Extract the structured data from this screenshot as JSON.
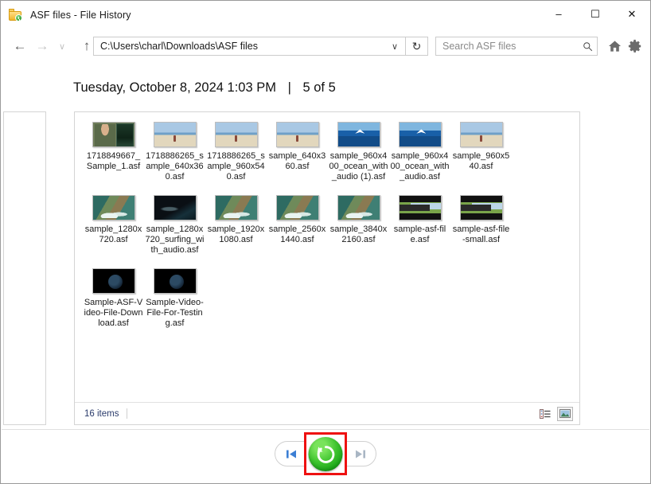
{
  "window": {
    "title": "ASF files - File History",
    "title_icon": "folder-history-icon",
    "controls": {
      "minimize": "–",
      "maximize": "☐",
      "close": "✕"
    }
  },
  "toolbar": {
    "back_icon": "←",
    "forward_icon": "→",
    "recent_icon": "∨",
    "up_icon": "↑",
    "address_value": "C:\\Users\\charl\\Downloads\\ASF files",
    "address_dropdown_icon": "∨",
    "refresh_icon": "↻",
    "search_placeholder": "Search ASF files",
    "search_icon": "⚲",
    "home_icon": "home-icon",
    "settings_icon": "gear-icon"
  },
  "header": {
    "datetime": "Tuesday, October 8, 2024 1:03 PM",
    "separator": "|",
    "position": "5 of 5"
  },
  "files": [
    {
      "name": "1718849667_Sample_1.asf",
      "thumb": "t-person"
    },
    {
      "name": "1718886265_sample_640x360.asf",
      "thumb": "t-beach"
    },
    {
      "name": "1718886265_sample_960x540.asf",
      "thumb": "t-beach"
    },
    {
      "name": "sample_640x360.asf",
      "thumb": "t-beach"
    },
    {
      "name": "sample_960x400_ocean_with_audio (1).asf",
      "thumb": "t-ocean"
    },
    {
      "name": "sample_960x400_ocean_with_audio.asf",
      "thumb": "t-ocean"
    },
    {
      "name": "sample_960x540.asf",
      "thumb": "t-beach"
    },
    {
      "name": "sample_1280x720.asf",
      "thumb": "t-rock"
    },
    {
      "name": "sample_1280x720_surfing_with_audio.asf",
      "thumb": "t-dark"
    },
    {
      "name": "sample_1920x1080.asf",
      "thumb": "t-rock"
    },
    {
      "name": "sample_2560x1440.asf",
      "thumb": "t-rock"
    },
    {
      "name": "sample_3840x2160.asf",
      "thumb": "t-rock"
    },
    {
      "name": "sample-asf-file.asf",
      "thumb": "t-cat"
    },
    {
      "name": "sample-asf-file-small.asf",
      "thumb": "t-cat"
    },
    {
      "name": "Sample-ASF-Video-File-Download.asf",
      "thumb": "t-moon"
    },
    {
      "name": "Sample-Video-File-For-Testing.asf",
      "thumb": "t-moon"
    }
  ],
  "status": {
    "item_count": "16 items",
    "view_details_icon": "details-view-icon",
    "view_thumbnails_icon": "thumbnails-view-icon"
  },
  "bottom_nav": {
    "previous_label": "previous-version-icon",
    "restore_label": "restore-icon",
    "next_label": "next-version-icon",
    "restore_color": "#2fbb2a",
    "highlight_color": "#ee1111"
  }
}
